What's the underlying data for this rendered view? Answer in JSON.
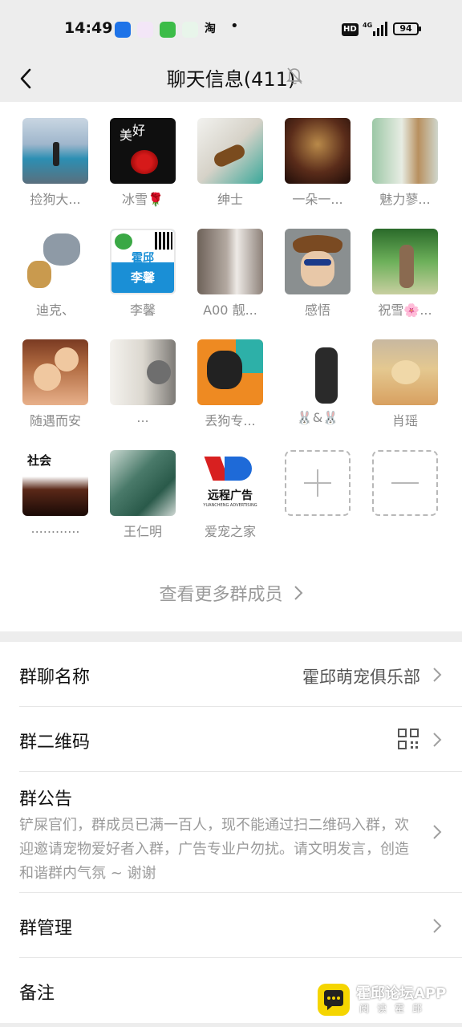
{
  "status_bar": {
    "time": "14:49",
    "taobao": "淘",
    "dot": "•",
    "hd": "HD",
    "network": "4G",
    "battery": "94"
  },
  "header": {
    "title": "聊天信息(411)"
  },
  "members": [
    {
      "name": "捡狗大..."
    },
    {
      "name": "冰雪🌹"
    },
    {
      "name": "绅士"
    },
    {
      "name": "一朵一..."
    },
    {
      "name": "魅力蓼..."
    },
    {
      "name": "迪克、"
    },
    {
      "name": "李馨"
    },
    {
      "name": "A00 靓..."
    },
    {
      "name": "感悟"
    },
    {
      "name": "祝雪🌸..."
    },
    {
      "name": "随遇而安"
    },
    {
      "name": "..."
    },
    {
      "name": "丢狗专..."
    },
    {
      "name": "🐰&🐰"
    },
    {
      "name": "肖瑶"
    },
    {
      "name": "............"
    },
    {
      "name": "王仁明"
    },
    {
      "name": "爱宠之家"
    }
  ],
  "avatar_texts": {
    "a1_line1": "美",
    "a1_line2": "好",
    "a6_brand": "霍邱",
    "a6_name": "李馨",
    "a15_title": "社会",
    "a17_brand": "远程广告",
    "a17_sub": "YUANCHENG ADVERTISING"
  },
  "more_members_label": "查看更多群成员",
  "settings": {
    "group_name_label": "群聊名称",
    "group_name_value": "霍邱萌宠俱乐部",
    "qr_label": "群二维码",
    "notice_label": "群公告",
    "notice_text": "铲屎官们，群成员已满一百人，现不能通过扫二维码入群，欢迎邀请宠物爱好者入群，广告专业户勿扰。请文明发言，创造和谐群内气氛 ~ 谢谢",
    "manage_label": "群管理",
    "remark_label": "备注"
  },
  "watermark": {
    "title": "霍邱论坛APP",
    "sub": "阅读霍邱"
  },
  "colors": {
    "page_bg": "#ededed",
    "panel_bg": "#ffffff",
    "secondary_text": "#8a8a8a"
  }
}
